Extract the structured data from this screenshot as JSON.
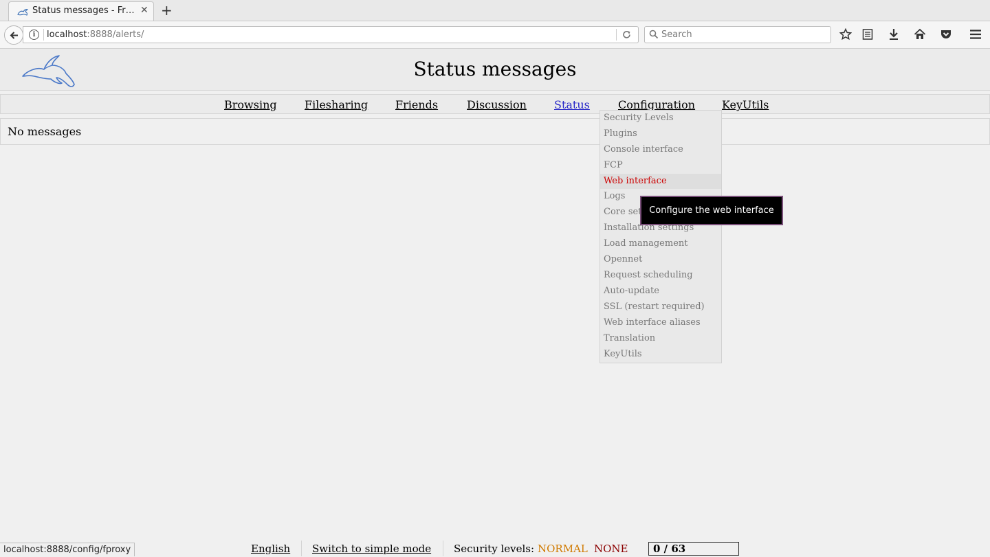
{
  "browser": {
    "tab_title": "Status messages - Fr…",
    "url_host": "localhost",
    "url_rest": ":8888/alerts/",
    "search_placeholder": "Search",
    "status_bar_url": "localhost:8888/config/fproxy"
  },
  "page": {
    "title": "Status messages",
    "message": "No messages"
  },
  "menu": {
    "items": [
      {
        "label": "Browsing"
      },
      {
        "label": "Filesharing"
      },
      {
        "label": "Friends"
      },
      {
        "label": "Discussion"
      },
      {
        "label": "Status",
        "active": true
      },
      {
        "label": "Configuration"
      },
      {
        "label": "KeyUtils"
      }
    ]
  },
  "config_dropdown": {
    "items": [
      "Security Levels",
      "Plugins",
      "Console interface",
      "FCP",
      "Web interface",
      "Logs",
      "Core sett",
      "Installation settings",
      "Load management",
      "Opennet",
      "Request scheduling",
      "Auto-update",
      "SSL (restart required)",
      "Web interface aliases",
      "Translation",
      "KeyUtils"
    ],
    "hovered_item": "Web interface",
    "tooltip": "Configure the web interface"
  },
  "footer": {
    "language": "English",
    "mode_switch": "Switch to simple mode",
    "security_label": "Security levels:",
    "security_network": "NORMAL",
    "security_friends": "NONE",
    "security_network_color": "#d07a00",
    "security_friends_color": "#8b0000",
    "progress_text": "0 / 63",
    "progress_fraction": 0
  }
}
